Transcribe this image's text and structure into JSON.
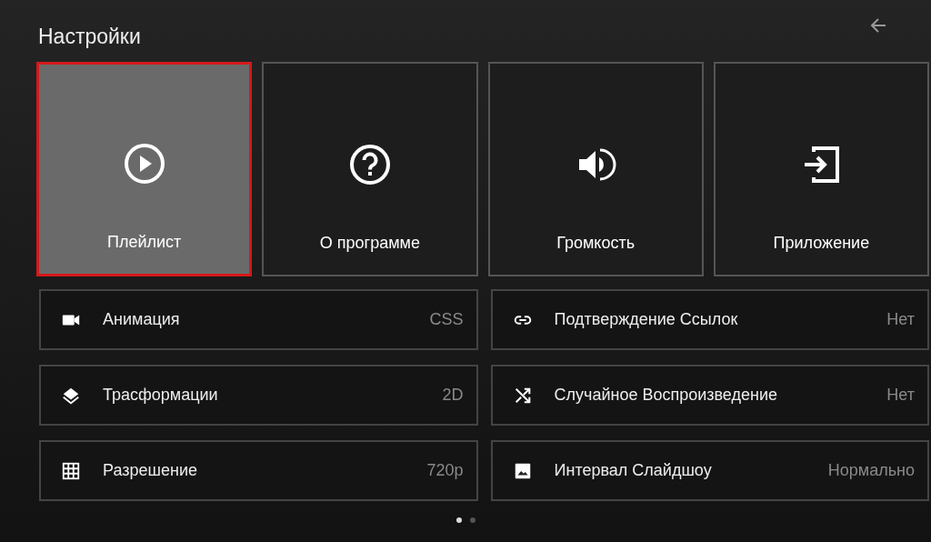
{
  "header": {
    "title": "Настройки"
  },
  "tiles": [
    {
      "label": "Плейлист",
      "selected": true
    },
    {
      "label": "О программе",
      "selected": false
    },
    {
      "label": "Громкость",
      "selected": false
    },
    {
      "label": "Приложение",
      "selected": false
    }
  ],
  "settings": [
    {
      "label": "Анимация",
      "value": "CSS"
    },
    {
      "label": "Подтверждение Ссылок",
      "value": "Нет"
    },
    {
      "label": "Трасформации",
      "value": "2D"
    },
    {
      "label": "Случайное Воспроизведение",
      "value": "Нет"
    },
    {
      "label": "Разрешение",
      "value": "720p"
    },
    {
      "label": "Интервал Слайдшоу",
      "value": "Нормально"
    }
  ],
  "pager": [
    {
      "selected": true
    },
    {
      "selected": false
    }
  ]
}
